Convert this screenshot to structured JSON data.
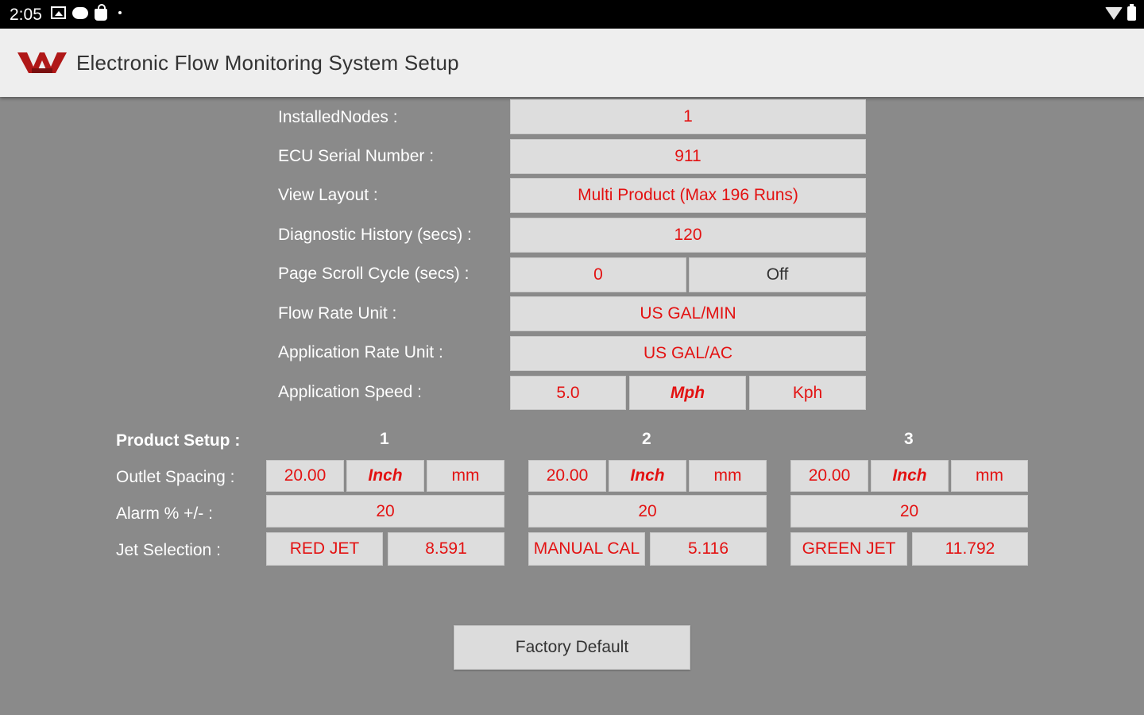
{
  "status_bar": {
    "time": "2:05"
  },
  "app": {
    "title": "Electronic Flow Monitoring System Setup"
  },
  "settings": {
    "installed_nodes": {
      "label": "InstalledNodes :",
      "value": "1"
    },
    "ecu_serial": {
      "label": "ECU Serial Number :",
      "value": "911"
    },
    "view_layout": {
      "label": "View Layout :",
      "value": "Multi Product (Max 196 Runs)"
    },
    "diagnostic_history": {
      "label": "Diagnostic History (secs) :",
      "value": "120"
    },
    "page_scroll": {
      "label": "Page Scroll Cycle (secs) :",
      "value": "0",
      "toggle": "Off"
    },
    "flow_rate_unit": {
      "label": "Flow Rate Unit :",
      "value": "US GAL/MIN"
    },
    "application_rate_unit": {
      "label": "Application Rate Unit :",
      "value": "US GAL/AC"
    },
    "application_speed": {
      "label": "Application Speed :",
      "value": "5.0",
      "unit_mph": "Mph",
      "unit_kph": "Kph"
    }
  },
  "product_setup": {
    "label": "Product Setup :",
    "outlet_label": "Outlet Spacing :",
    "alarm_label": "Alarm % +/- :",
    "jet_label": "Jet Selection :",
    "products": [
      {
        "number": "1",
        "spacing": "20.00",
        "unit_inch": "Inch",
        "unit_mm": "mm",
        "alarm": "20",
        "jet": "RED JET",
        "jet_value": "8.591"
      },
      {
        "number": "2",
        "spacing": "20.00",
        "unit_inch": "Inch",
        "unit_mm": "mm",
        "alarm": "20",
        "jet": "MANUAL CAL",
        "jet_value": "5.116"
      },
      {
        "number": "3",
        "spacing": "20.00",
        "unit_inch": "Inch",
        "unit_mm": "mm",
        "alarm": "20",
        "jet": "GREEN JET",
        "jet_value": "11.792"
      }
    ]
  },
  "factory_default": {
    "label": "Factory Default"
  },
  "colors": {
    "background": "#8a8a8a",
    "value_text": "#e31212",
    "cell_bg": "#dddddd",
    "app_bar": "#eeeeee"
  }
}
